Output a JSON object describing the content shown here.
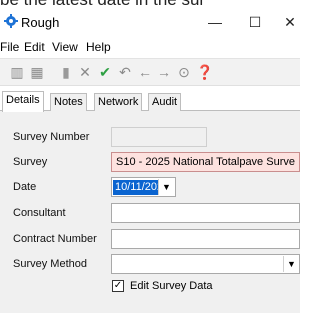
{
  "top_cutoff_text": "be the latest date in the sur",
  "window": {
    "title": "Rough",
    "app_icon": "gear-icon",
    "minimize_glyph": "—",
    "maximize_glyph": "☐",
    "close_glyph": "✕"
  },
  "menu": {
    "items": [
      {
        "label": "File"
      },
      {
        "label": "Edit"
      },
      {
        "label": "View"
      },
      {
        "label": "Help"
      }
    ]
  },
  "toolbar": {
    "icons": [
      {
        "name": "grid-icon",
        "glyph": "▥",
        "color": "#8a8a8a"
      },
      {
        "name": "grid-alt-icon",
        "glyph": "▦",
        "color": "#8a8a8a"
      },
      {
        "name": "document-icon",
        "glyph": "▮",
        "color": "#9a9a9a"
      },
      {
        "name": "delete-icon",
        "glyph": "✕",
        "color": "#8a8a8a"
      },
      {
        "name": "check-icon",
        "glyph": "✔",
        "color": "#2ea043"
      },
      {
        "name": "undo-icon",
        "glyph": "↶",
        "color": "#8a8a8a"
      },
      {
        "name": "back-arrow-icon",
        "glyph": "←",
        "color": "#8a8a8a"
      },
      {
        "name": "forward-arrow-icon",
        "glyph": "→",
        "color": "#8a8a8a"
      },
      {
        "name": "refresh-icon",
        "glyph": "⊙",
        "color": "#8a8a8a"
      },
      {
        "name": "help-icon",
        "glyph": "❓",
        "color": "#2b56c6"
      }
    ]
  },
  "tabs": [
    {
      "label": "Details",
      "active": true
    },
    {
      "label": "Notes",
      "active": false
    },
    {
      "label": "Network",
      "active": false
    },
    {
      "label": "Audit",
      "active": false
    }
  ],
  "form": {
    "survey_number": {
      "label": "Survey Number",
      "value": ""
    },
    "survey": {
      "label": "Survey",
      "value": "S10 - 2025 National Totalpave Surve"
    },
    "date": {
      "label": "Date",
      "value": "10/11/2025"
    },
    "consultant": {
      "label": "Consultant",
      "value": ""
    },
    "contract_number": {
      "label": "Contract Number",
      "value": ""
    },
    "survey_method": {
      "label": "Survey Method",
      "value": ""
    },
    "edit_survey_data": {
      "label": "Edit Survey Data",
      "checked": true
    }
  },
  "colors": {
    "survey_field_bg": "#fde2df",
    "date_highlight": "#0a64d0",
    "panel_bg": "#f0f0f0"
  }
}
